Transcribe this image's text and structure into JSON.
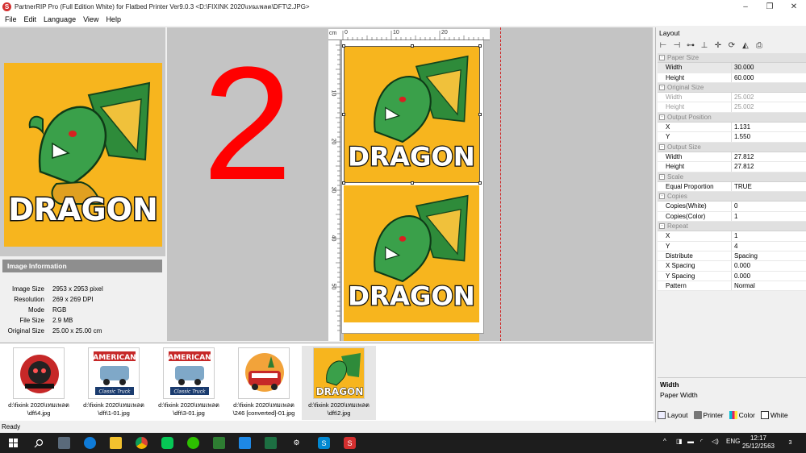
{
  "window": {
    "title": "PartnerRIP Pro (Full Edition White) for Flatbed Printer Ver9.0.3 <D:\\FIXINK 2020\\เทมเพลต\\DFT\\2.JPG>",
    "minimize": "–",
    "maximize": "❐",
    "close": "✕"
  },
  "menu": [
    "File",
    "Edit",
    "Language",
    "View",
    "Help"
  ],
  "canvas": {
    "big_text": "2",
    "ruler_unit": "cm",
    "ruler_top": [
      "0",
      "10",
      "20"
    ],
    "ruler_left": [
      "10",
      "20",
      "30",
      "40",
      "50"
    ]
  },
  "artwork": {
    "word": "DRAGON"
  },
  "image_info": {
    "header": "Image Information",
    "rows": [
      {
        "label": "Image Size",
        "value": "2953 x 2953 pixel"
      },
      {
        "label": "Resolution",
        "value": "269 x 269 DPI"
      },
      {
        "label": "Mode",
        "value": "RGB"
      },
      {
        "label": "File Size",
        "value": "2.9 MB"
      },
      {
        "label": "Original Size",
        "value": "25.00 x 25.00 cm"
      }
    ]
  },
  "thumbnails": [
    {
      "line1": "d:\\fixink 2020\\เทมเพลต",
      "line2": "\\dft\\4.jpg"
    },
    {
      "line1": "d:\\fixink 2020\\เทมเพลต",
      "line2": "\\dft\\1-01.jpg",
      "art_top": "AMERICAN",
      "art_bottom": "Classic Truck"
    },
    {
      "line1": "d:\\fixink 2020\\เทมเพลต",
      "line2": "\\dft\\3-01.jpg",
      "art_top": "AMERICAN",
      "art_bottom": "Classic Truck"
    },
    {
      "line1": "d:\\fixink 2020\\เทมเพลต",
      "line2": "\\246 [converted]-01.jpg"
    },
    {
      "line1": "d:\\fixink 2020\\เทมเพลต",
      "line2": "\\dft\\2.jpg",
      "art_top": "DRAGON"
    }
  ],
  "panel": {
    "title": "Layout",
    "categories": [
      {
        "name": "Paper Size",
        "rows": [
          {
            "name": "Width",
            "value": "30.000"
          },
          {
            "name": "Height",
            "value": "60.000"
          }
        ]
      },
      {
        "name": "Original Size",
        "rows": [
          {
            "name": "Width",
            "value": "25.002"
          },
          {
            "name": "Height",
            "value": "25.002"
          }
        ]
      },
      {
        "name": "Output Position",
        "rows": [
          {
            "name": "X",
            "value": "1.131"
          },
          {
            "name": "Y",
            "value": "1.550"
          }
        ]
      },
      {
        "name": "Output Size",
        "rows": [
          {
            "name": "Width",
            "value": "27.812"
          },
          {
            "name": "Height",
            "value": "27.812"
          }
        ]
      },
      {
        "name": "Scale",
        "rows": [
          {
            "name": "Equal Proportion",
            "value": "TRUE"
          }
        ]
      },
      {
        "name": "Copies",
        "rows": [
          {
            "name": "Copies(White)",
            "value": "0"
          },
          {
            "name": "Copies(Color)",
            "value": "1"
          }
        ]
      },
      {
        "name": "Repeat",
        "rows": [
          {
            "name": "X",
            "value": "1"
          },
          {
            "name": "Y",
            "value": "4"
          },
          {
            "name": "Distribute",
            "value": "Spacing"
          },
          {
            "name": "X Spacing",
            "value": "0.000"
          },
          {
            "name": "Y Spacing",
            "value": "0.000"
          },
          {
            "name": "Pattern",
            "value": "Normal"
          }
        ]
      }
    ],
    "desc_title": "Width",
    "desc_text": "Paper Width",
    "tabs": [
      "Layout",
      "Printer",
      "Color",
      "White"
    ]
  },
  "status": "Ready",
  "taskbar": {
    "tray_lang": "ENG",
    "tray_icons": "^",
    "time": "12:17",
    "date": "25/12/2563",
    "notif": "3"
  }
}
